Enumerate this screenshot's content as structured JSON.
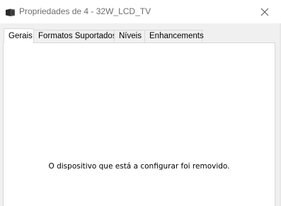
{
  "window": {
    "title": "Propriedades de 4 - 32W_LCD_TV",
    "icon": "device-icon",
    "close_icon": "close-icon"
  },
  "tabs": [
    {
      "label": "Gerais",
      "active": true
    },
    {
      "label": "Formatos Suportados",
      "active": false
    },
    {
      "label": "Níveis",
      "active": false
    },
    {
      "label": "Enhancements",
      "active": false
    }
  ],
  "content": {
    "message": "O dispositivo que está a configurar foi removido."
  },
  "colors": {
    "title_text": "#6d6d6d",
    "tab_border": "#d9d9d9",
    "panel_bg": "#ffffff",
    "window_bg": "#f0f0f0"
  }
}
